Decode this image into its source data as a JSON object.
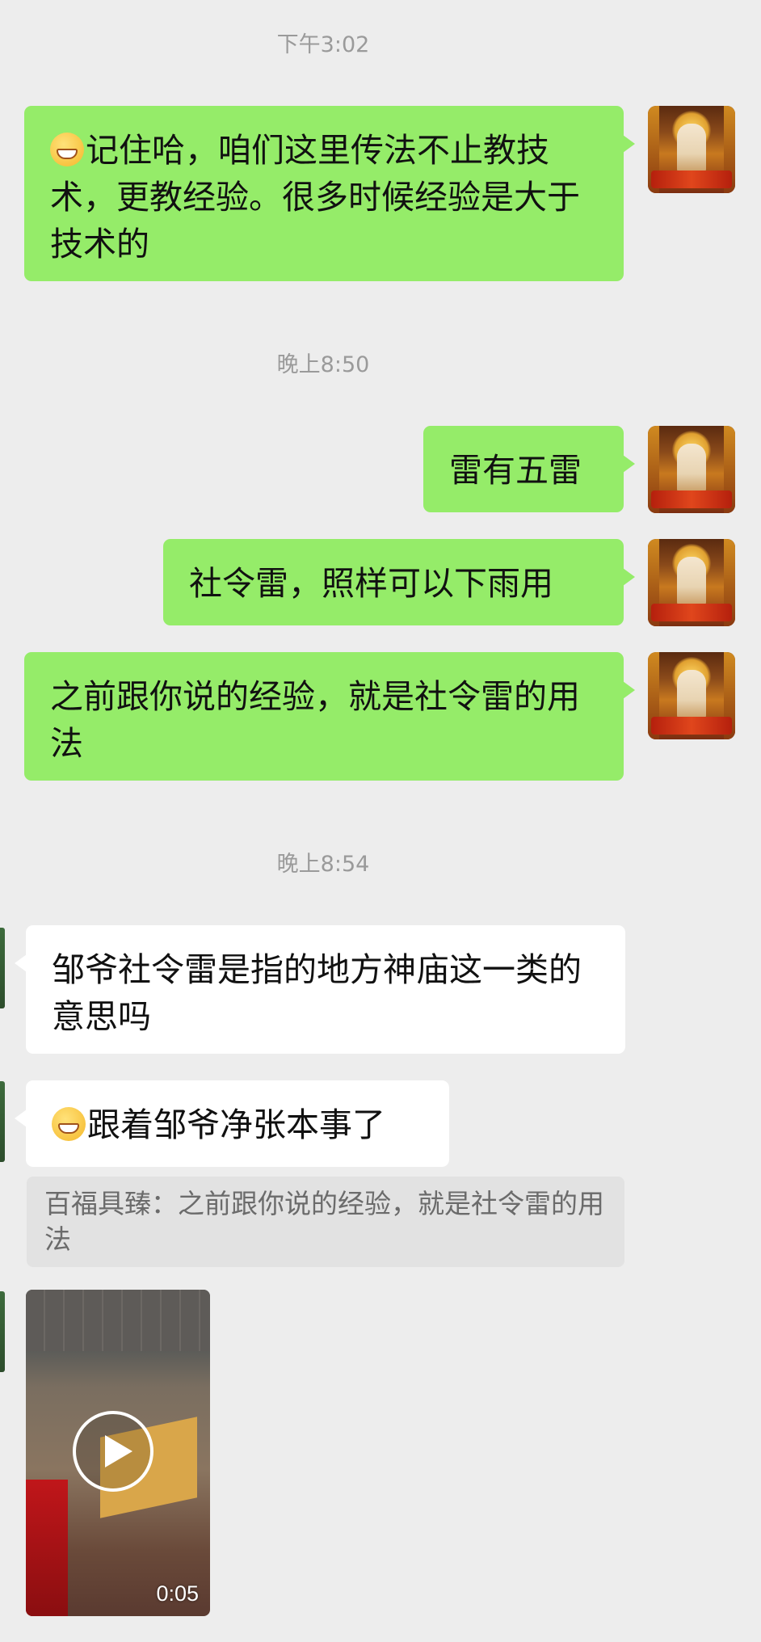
{
  "timestamps": [
    "下午3:02",
    "晚上8:50",
    "晚上8:54"
  ],
  "messages": {
    "m1": "记住哈，咱们这里传法不止教技术，更教经验。很多时候经验是大于技术的",
    "m2": "雷有五雷",
    "m3": "社令雷，照样可以下雨用",
    "m4": "之前跟你说的经验，就是社令雷的用法",
    "m5": "邹爷社令雷是指的地方神庙这一类的意思吗",
    "m6": "跟着邹爷净张本事了"
  },
  "quote": "百福具臻：之前跟你说的经验，就是社令雷的用法",
  "video": {
    "duration": "0:05"
  },
  "icons": {
    "emoji": "grinning-face-icon",
    "play": "play-icon"
  },
  "colors": {
    "background": "#ededed",
    "sent_bubble": "#95ec69",
    "received_bubble": "#ffffff",
    "timestamp": "#9a9a9a"
  }
}
